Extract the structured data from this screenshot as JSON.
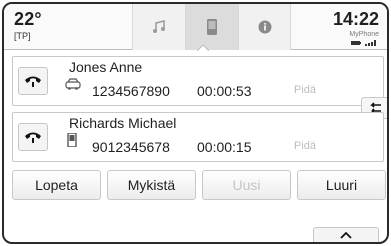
{
  "status": {
    "temperature": "22°",
    "tp_label": "[TP]",
    "time": "14:22",
    "device_name": "MyPhone"
  },
  "tabs": [
    {
      "icon": "audio-icon"
    },
    {
      "icon": "phone-icon",
      "active": true
    },
    {
      "icon": "info-icon"
    }
  ],
  "calls": [
    {
      "name": "Jones Anne",
      "icon": "car-phone-icon",
      "number": "1234567890",
      "duration": "00:00:53",
      "hold_label": "Pidä"
    },
    {
      "name": "Richards Michael",
      "icon": "mobile-phone-icon",
      "number": "9012345678",
      "duration": "00:00:15",
      "hold_label": "Pidä"
    }
  ],
  "actions": {
    "end": "Lopeta",
    "mute": "Mykistä",
    "new": "Uusi",
    "handset": "Luuri"
  },
  "colors": {
    "border": "#2a2a2a",
    "disabled_text": "#c4c4c4",
    "active_tab": "#dcdcdc"
  }
}
